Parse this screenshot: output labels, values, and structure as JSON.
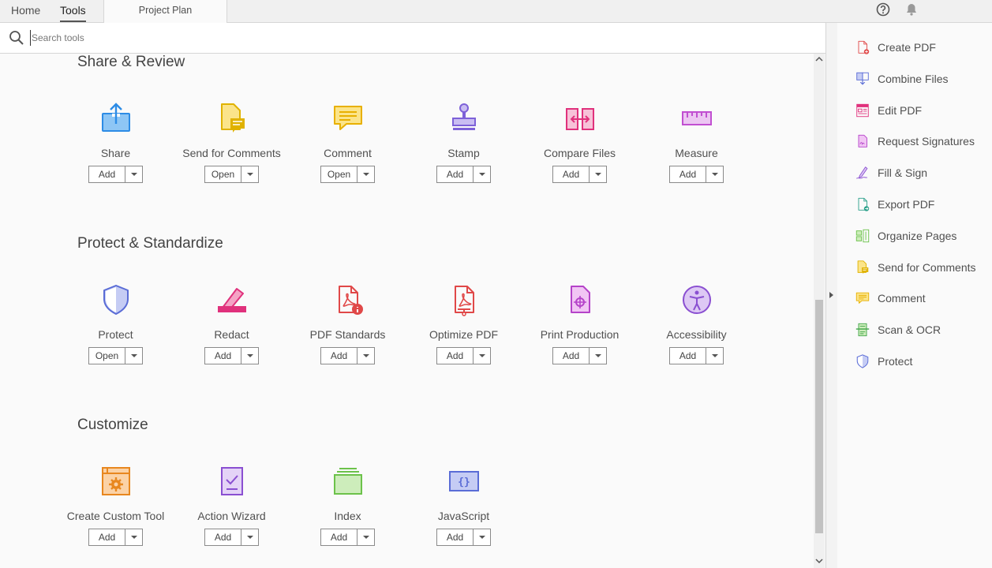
{
  "tabs": {
    "home": "Home",
    "tools": "Tools",
    "document": "Project Plan"
  },
  "search": {
    "placeholder": "Search tools",
    "value": ""
  },
  "sections": [
    {
      "title": "Share & Review",
      "tools": [
        {
          "name": "Share",
          "action": "Add",
          "icon": "share-icon",
          "color": "#2d8ce6"
        },
        {
          "name": "Send for Comments",
          "action": "Open",
          "icon": "send-for-comments-icon",
          "color": "#e0b200"
        },
        {
          "name": "Comment",
          "action": "Open",
          "icon": "comment-icon",
          "color": "#e8b000"
        },
        {
          "name": "Stamp",
          "action": "Add",
          "icon": "stamp-icon",
          "color": "#7d61d8"
        },
        {
          "name": "Compare Files",
          "action": "Add",
          "icon": "compare-files-icon",
          "color": "#e0317c"
        },
        {
          "name": "Measure",
          "action": "Add",
          "icon": "measure-icon",
          "color": "#c14fd1"
        }
      ]
    },
    {
      "title": "Protect & Standardize",
      "tools": [
        {
          "name": "Protect",
          "action": "Open",
          "icon": "protect-shield-icon",
          "color": "#5a6cd6"
        },
        {
          "name": "Redact",
          "action": "Add",
          "icon": "redact-icon",
          "color": "#e0317c"
        },
        {
          "name": "PDF Standards",
          "action": "Add",
          "icon": "pdf-standards-icon",
          "color": "#e04848"
        },
        {
          "name": "Optimize PDF",
          "action": "Add",
          "icon": "optimize-pdf-icon",
          "color": "#e04848"
        },
        {
          "name": "Print Production",
          "action": "Add",
          "icon": "print-production-icon",
          "color": "#b543c9"
        },
        {
          "name": "Accessibility",
          "action": "Add",
          "icon": "accessibility-icon",
          "color": "#8a4fd1"
        }
      ]
    },
    {
      "title": "Customize",
      "tools": [
        {
          "name": "Create Custom Tool",
          "action": "Add",
          "icon": "create-custom-tool-icon",
          "color": "#e8871e"
        },
        {
          "name": "Action Wizard",
          "action": "Add",
          "icon": "action-wizard-icon",
          "color": "#8a4fd1"
        },
        {
          "name": "Index",
          "action": "Add",
          "icon": "index-icon",
          "color": "#6cc24a"
        },
        {
          "name": "JavaScript",
          "action": "Add",
          "icon": "javascript-icon",
          "color": "#5a6cd6"
        }
      ]
    }
  ],
  "right_panel": [
    {
      "label": "Create PDF",
      "icon": "create-pdf-icon",
      "color": "#e04848"
    },
    {
      "label": "Combine Files",
      "icon": "combine-files-icon",
      "color": "#5a6cd6"
    },
    {
      "label": "Edit PDF",
      "icon": "edit-pdf-icon",
      "color": "#e0317c"
    },
    {
      "label": "Request Signatures",
      "icon": "request-signatures-icon",
      "color": "#b543c9"
    },
    {
      "label": "Fill & Sign",
      "icon": "fill-sign-icon",
      "color": "#8a4fd1"
    },
    {
      "label": "Export PDF",
      "icon": "export-pdf-icon",
      "color": "#2aa08a"
    },
    {
      "label": "Organize Pages",
      "icon": "organize-pages-icon",
      "color": "#6cc24a"
    },
    {
      "label": "Send for Comments",
      "icon": "send-for-comments-icon",
      "color": "#e0b200"
    },
    {
      "label": "Comment",
      "icon": "comment-icon",
      "color": "#e8b000"
    },
    {
      "label": "Scan & OCR",
      "icon": "scan-ocr-icon",
      "color": "#3fa348"
    },
    {
      "label": "Protect",
      "icon": "protect-shield-icon",
      "color": "#5a6cd6"
    }
  ]
}
